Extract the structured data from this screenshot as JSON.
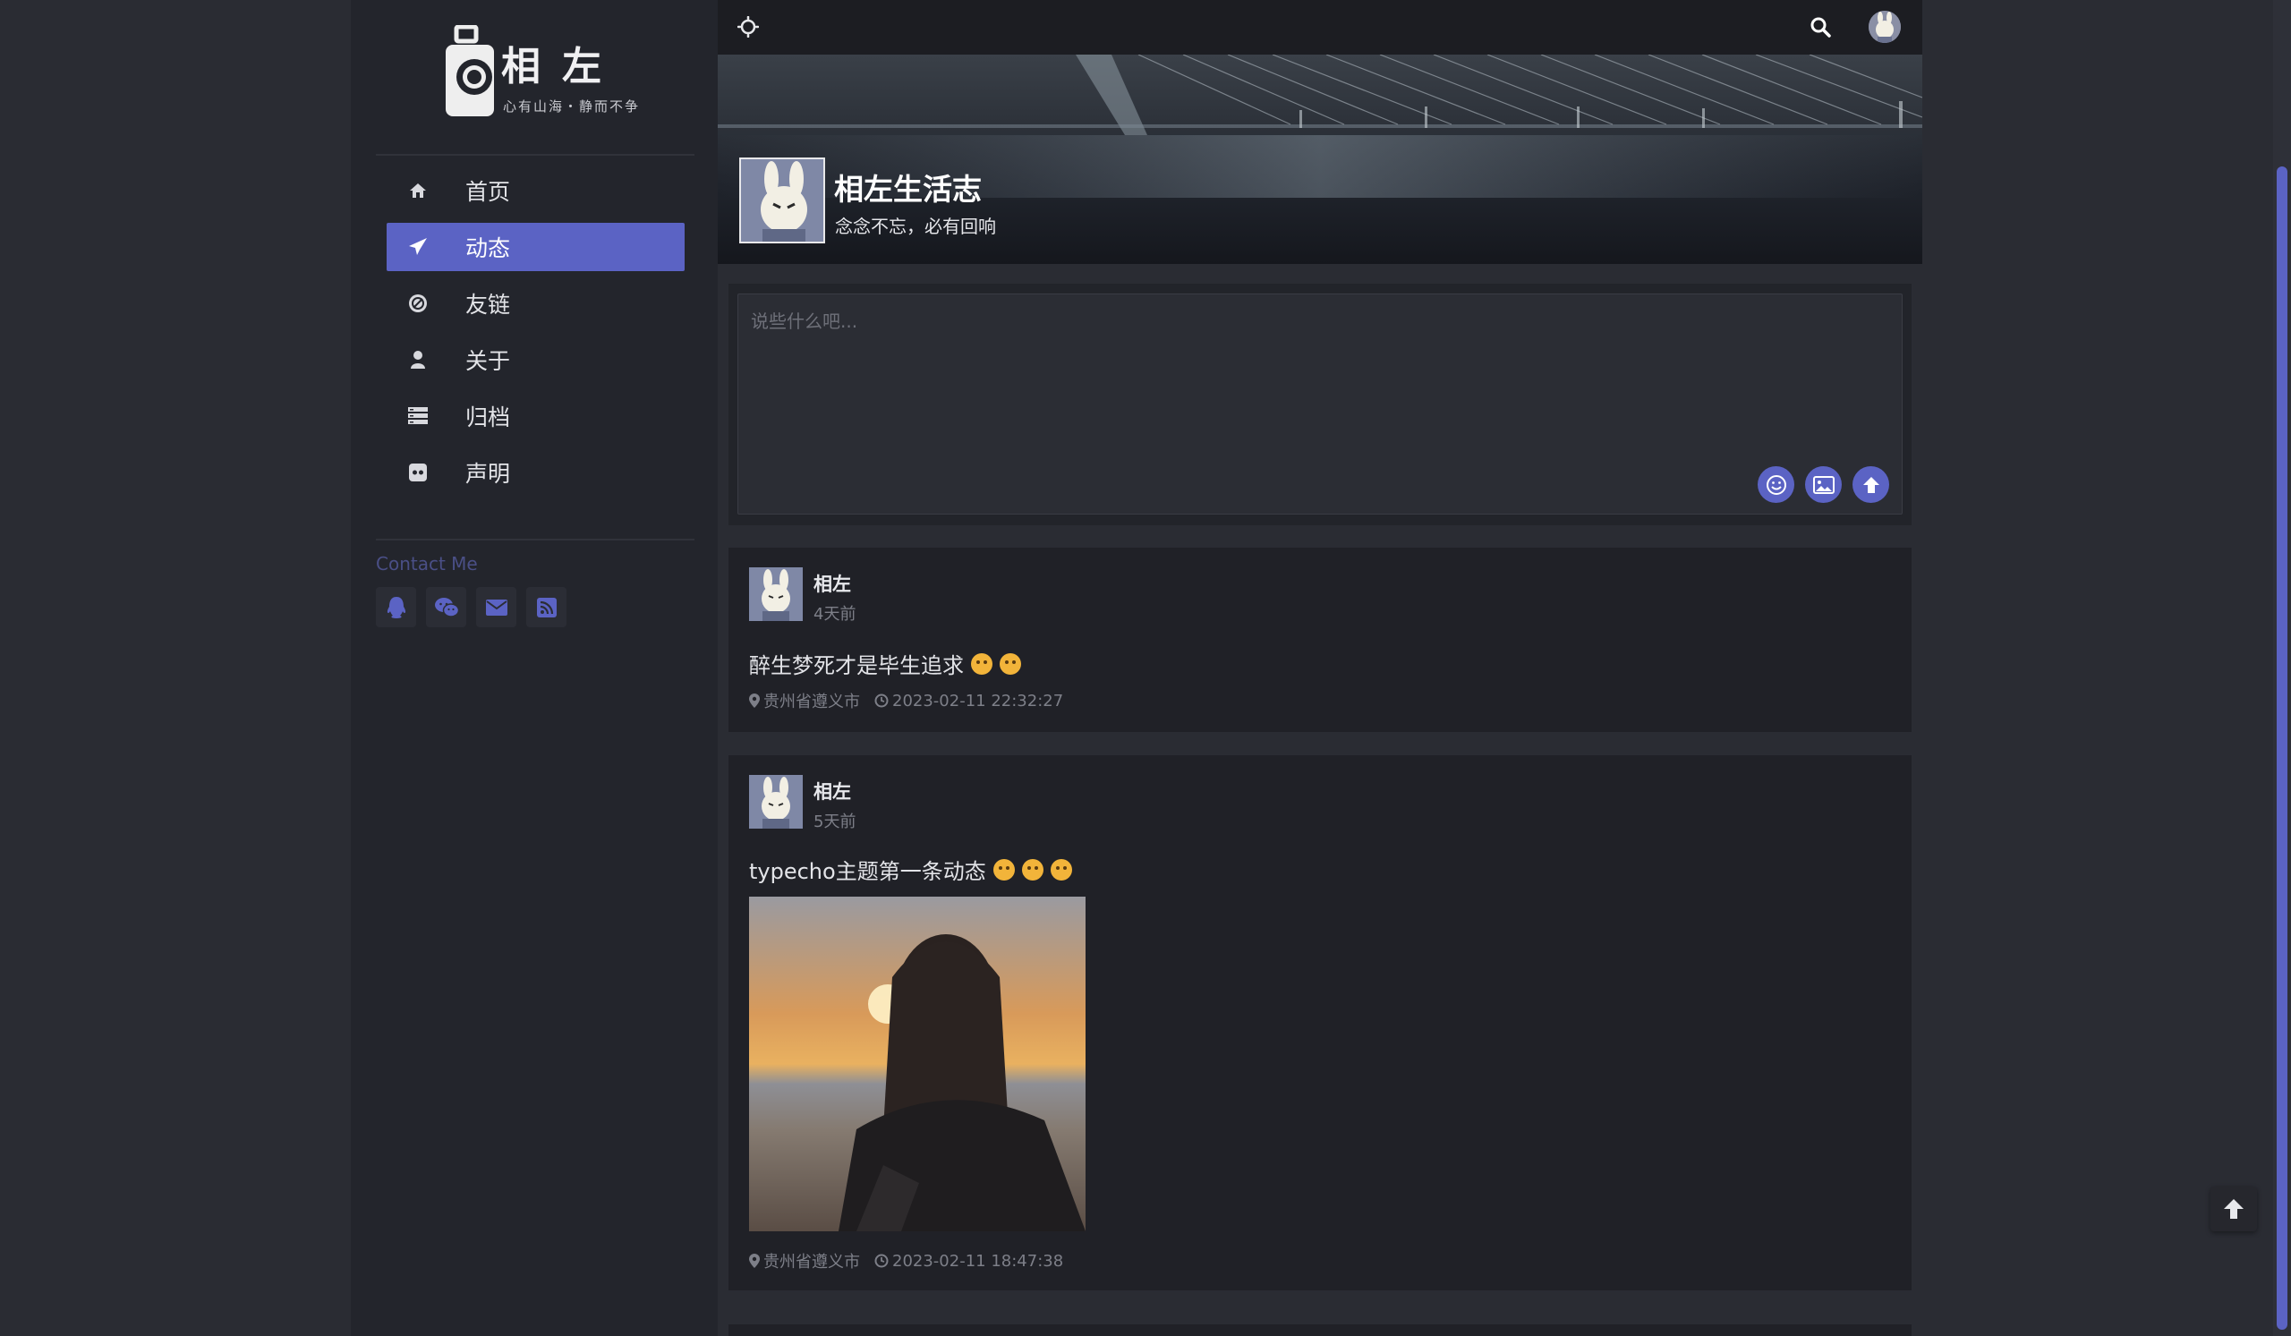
{
  "sidebar": {
    "logo_title": "相左",
    "logo_slogan": "心有山海・静而不争",
    "nav": [
      {
        "label": "首页",
        "icon": "home-icon",
        "active": false
      },
      {
        "label": "动态",
        "icon": "send-icon",
        "active": true
      },
      {
        "label": "友链",
        "icon": "link-icon",
        "active": false
      },
      {
        "label": "关于",
        "icon": "user-icon",
        "active": false
      },
      {
        "label": "归档",
        "icon": "archive-icon",
        "active": false
      },
      {
        "label": "声明",
        "icon": "notice-icon",
        "active": false
      }
    ],
    "contact_title": "Contact Me",
    "contacts": [
      "qq-icon",
      "wechat-icon",
      "mail-icon",
      "rss-icon"
    ]
  },
  "banner": {
    "title": "相左生活志",
    "subtitle": "念念不忘，必有回响"
  },
  "composer": {
    "placeholder": "说些什么吧..."
  },
  "posts": [
    {
      "author": "相左",
      "time_ago": "4天前",
      "content": "醉生梦死才是毕生追求",
      "location": "贵州省遵义市",
      "datetime": "2023-02-11 22:32:27"
    },
    {
      "author": "相左",
      "time_ago": "5天前",
      "content": "typecho主题第一条动态",
      "location": "贵州省遵义市",
      "datetime": "2023-02-11 18:47:38"
    }
  ],
  "colors": {
    "accent": "#5b63c4",
    "sidebar_bg": "#23252c",
    "card_bg": "#202127"
  }
}
